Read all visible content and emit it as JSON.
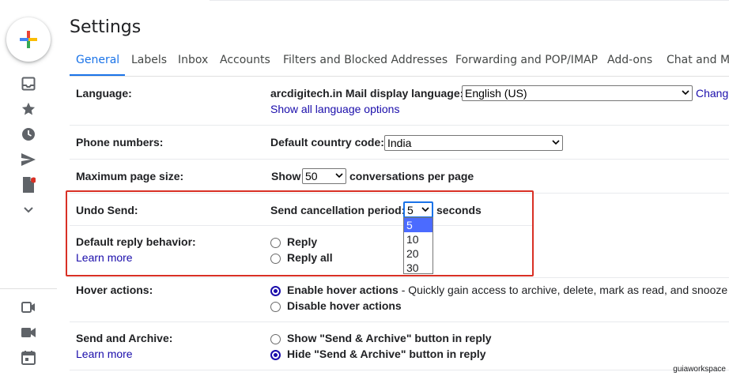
{
  "header": {
    "title": "Settings"
  },
  "tabs": [
    {
      "label": "General",
      "active": true
    },
    {
      "label": "Labels"
    },
    {
      "label": "Inbox"
    },
    {
      "label": "Accounts"
    },
    {
      "label": "Filters and Blocked Addresses"
    },
    {
      "label": "Forwarding and POP/IMAP"
    },
    {
      "label": "Add-ons"
    },
    {
      "label": "Chat and Me"
    }
  ],
  "rail": {
    "icons": [
      "compose-icon",
      "inbox-icon",
      "starred-icon",
      "snoozed-icon",
      "sent-icon",
      "drafts-icon",
      "more-icon",
      "meet-icon",
      "video-icon",
      "calendar-icon"
    ],
    "notification_color": "#d93025"
  },
  "language": {
    "label": "Language:",
    "display_label": "arcdigitech.in Mail display language:",
    "selected": "English (US)",
    "change_link": "Chang",
    "show_all_link": "Show all language options"
  },
  "phone": {
    "label": "Phone numbers:",
    "country_label": "Default country code:",
    "selected": "India"
  },
  "page_size": {
    "label": "Maximum page size:",
    "show": "Show",
    "selected": "50",
    "suffix": "conversations per page"
  },
  "undo_send": {
    "label": "Undo Send:",
    "period_label": "Send cancellation period:",
    "selected": "5",
    "suffix": "seconds",
    "options": [
      "5",
      "10",
      "20",
      "30"
    ]
  },
  "reply": {
    "label": "Default reply behavior:",
    "learn_more": "Learn more",
    "options": [
      {
        "label": "Reply",
        "checked": false
      },
      {
        "label": "Reply all",
        "checked": false
      }
    ]
  },
  "hover": {
    "label": "Hover actions:",
    "options": [
      {
        "label": "Enable hover actions",
        "detail": " - Quickly gain access to archive, delete, mark as read, and snooze",
        "checked": true
      },
      {
        "label": "Disable hover actions",
        "checked": false
      }
    ]
  },
  "send_archive": {
    "label": "Send and Archive:",
    "learn_more": "Learn more",
    "options": [
      {
        "label": "Show \"Send & Archive\" button in reply",
        "checked": false
      },
      {
        "label": "Hide \"Send & Archive\" button in reply",
        "checked": true
      }
    ]
  },
  "watermark": "guiaworkspace",
  "colors": {
    "accent": "#1a73e8",
    "link": "#1a0dab",
    "highlight": "#d93025",
    "option_selected": "#4b6bff"
  }
}
